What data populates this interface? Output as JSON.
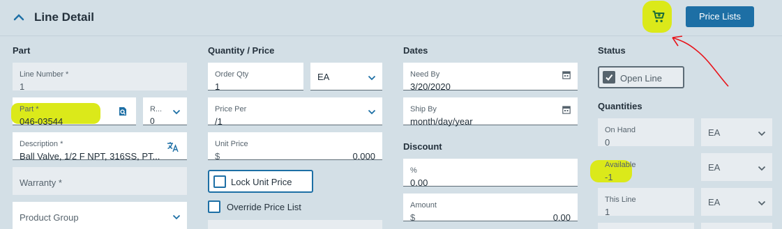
{
  "header": {
    "title": "Line Detail",
    "price_lists_label": "Price Lists",
    "collapse_icon": "chevron-up-icon",
    "cart_icon": "cart-icon"
  },
  "part": {
    "section": "Part",
    "line_number_label": "Line Number *",
    "line_number_value": "1",
    "part_label": "Part *",
    "part_value": "046-03544",
    "rev_label": "R...",
    "rev_value": "0",
    "description_label": "Description *",
    "description_value": "Ball Valve, 1/2 F NPT, 316SS, PT...",
    "warranty_placeholder": "Warranty *",
    "product_group_placeholder": "Product Group"
  },
  "quantity_price": {
    "section": "Quantity / Price",
    "order_qty_label": "Order Qty",
    "order_qty_value": "1",
    "uom_value": "EA",
    "price_per_label": "Price Per",
    "price_per_value": "/1",
    "unit_price_label": "Unit Price",
    "unit_price_currency": "$",
    "unit_price_value": "0.000",
    "lock_unit_price_label": "Lock Unit Price",
    "override_price_list_label": "Override Price List"
  },
  "dates": {
    "section": "Dates",
    "need_by_label": "Need By",
    "need_by_value": "3/20/2020",
    "ship_by_label": "Ship By",
    "ship_by_value": "month/day/year"
  },
  "discount": {
    "section": "Discount",
    "percent_label": "%",
    "percent_value": "0.00",
    "amount_label": "Amount",
    "amount_currency": "$",
    "amount_value": "0.00"
  },
  "status": {
    "section": "Status",
    "open_line_label": "Open Line"
  },
  "quantities": {
    "section": "Quantities",
    "on_hand_label": "On Hand",
    "on_hand_value": "0",
    "on_hand_uom": "EA",
    "available_label": "Available",
    "available_value": "-1",
    "available_uom": "EA",
    "this_line_label": "This Line",
    "this_line_value": "1",
    "this_line_uom": "EA"
  },
  "colors": {
    "highlight": "#dbe91a",
    "accent": "#1d6fa5",
    "annotation": "#e8141b"
  }
}
